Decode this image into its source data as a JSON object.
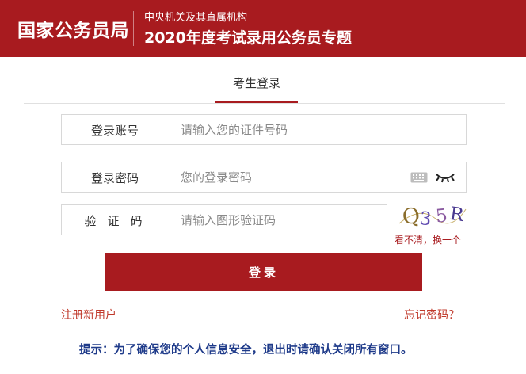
{
  "header": {
    "brand": "国家公务员局",
    "subtitle_small": "中央机关及其直属机构",
    "subtitle_large": "2020年度考试录用公务员专题",
    "bg_color": "#a81b1f"
  },
  "tab": {
    "label": "考生登录"
  },
  "form": {
    "account": {
      "label": "登录账号",
      "placeholder": "请输入您的证件号码",
      "value": ""
    },
    "password": {
      "label": "登录密码",
      "placeholder": "您的登录密码",
      "value": "",
      "keyboard_icon": "keyboard-icon",
      "eye_icon": "eye-closed-icon"
    },
    "captcha": {
      "label": "验证码",
      "placeholder": "请输入图形验证码",
      "value": "",
      "image_text": "Q35R",
      "refresh_label": "看不清，换一个"
    }
  },
  "buttons": {
    "login": "登录"
  },
  "links": {
    "register": "注册新用户",
    "forgot": "忘记密码？"
  },
  "tip": "提示：为了确保您的个人信息安全，退出时请确认关闭所有窗口。",
  "colors": {
    "accent": "#a81b1f",
    "link": "#c0392b",
    "tip": "#1f3b8a"
  }
}
